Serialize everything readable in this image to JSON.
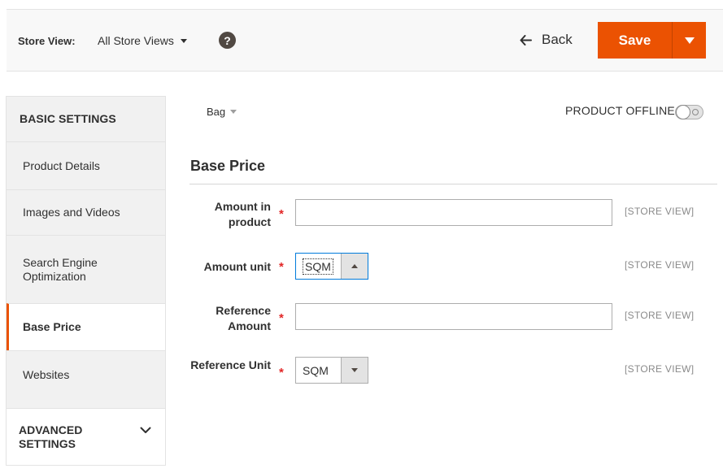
{
  "header": {
    "store_view_label": "Store View:",
    "store_view_value": "All Store Views",
    "help_symbol": "?",
    "back_label": "Back",
    "save_label": "Save"
  },
  "sidebar": {
    "basic_heading": "BASIC SETTINGS",
    "items": [
      {
        "label": "Product Details"
      },
      {
        "label": "Images and Videos"
      },
      {
        "label": "Search Engine Optimization"
      },
      {
        "label": "Base Price",
        "active": true
      },
      {
        "label": "Websites"
      }
    ],
    "advanced_heading": "ADVANCED SETTINGS"
  },
  "content": {
    "breadcrumb": "Bag",
    "product_offline_label": "PRODUCT OFFLINE",
    "product_offline_on": false,
    "section_title": "Base Price",
    "required_marker": "*",
    "fields": [
      {
        "label": "Amount in product",
        "type": "text",
        "value": "",
        "scope": "[STORE VIEW]"
      },
      {
        "label": "Amount unit",
        "type": "select",
        "value": "SQM",
        "scope": "[STORE VIEW]",
        "open": true
      },
      {
        "label": "Reference Amount",
        "type": "text",
        "value": "",
        "scope": "[STORE VIEW]"
      },
      {
        "label": "Reference Unit",
        "type": "select",
        "value": "SQM",
        "scope": "[STORE VIEW]",
        "open": false
      }
    ]
  },
  "colors": {
    "accent": "#eb5202",
    "required": "#e22626",
    "focus": "#007bdb"
  }
}
